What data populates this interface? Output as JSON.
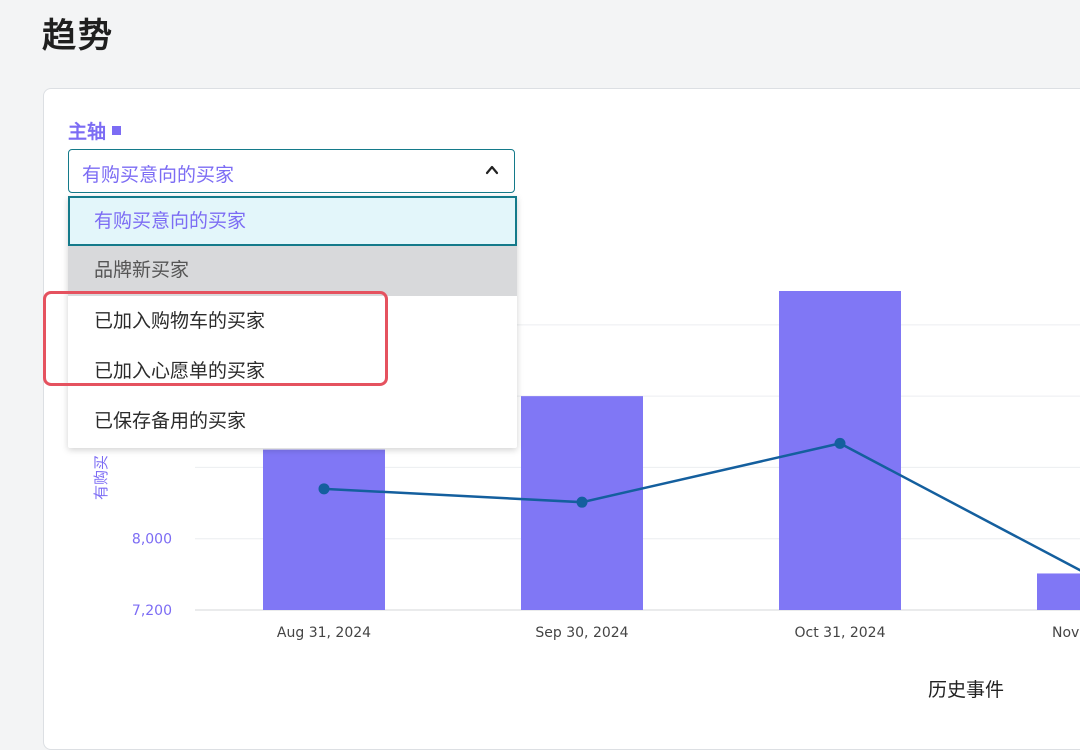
{
  "page": {
    "title": "趋势"
  },
  "panel": {
    "axis_label": "主轴",
    "select": {
      "value": "有购买意向的买家"
    },
    "options": [
      {
        "label": "有购买意向的买家",
        "state": "selected"
      },
      {
        "label": "品牌新买家",
        "state": "hovered"
      },
      {
        "label": "已加入购物车的买家",
        "state": "normal"
      },
      {
        "label": "已加入心愿单的买家",
        "state": "normal"
      },
      {
        "label": "已保存备用的买家",
        "state": "normal"
      }
    ],
    "annotation_color": "#e5525f"
  },
  "chart_data": {
    "type": "bar",
    "categories": [
      "Aug 31, 2024",
      "Sep 30, 2024",
      "Oct 31, 2024",
      "Nov"
    ],
    "series": [
      {
        "type": "bar",
        "values": [
          9000,
          9600,
          10780,
          7610
        ],
        "color": "#8077f5"
      },
      {
        "type": "line",
        "values": [
          8560,
          8410,
          9070,
          7540
        ],
        "color": "#145f9e"
      }
    ],
    "xlabel": "历史事件",
    "ylabel": "有购买",
    "yticks": [
      "7,200",
      "8,000"
    ],
    "ylim": [
      7200,
      10780
    ]
  }
}
